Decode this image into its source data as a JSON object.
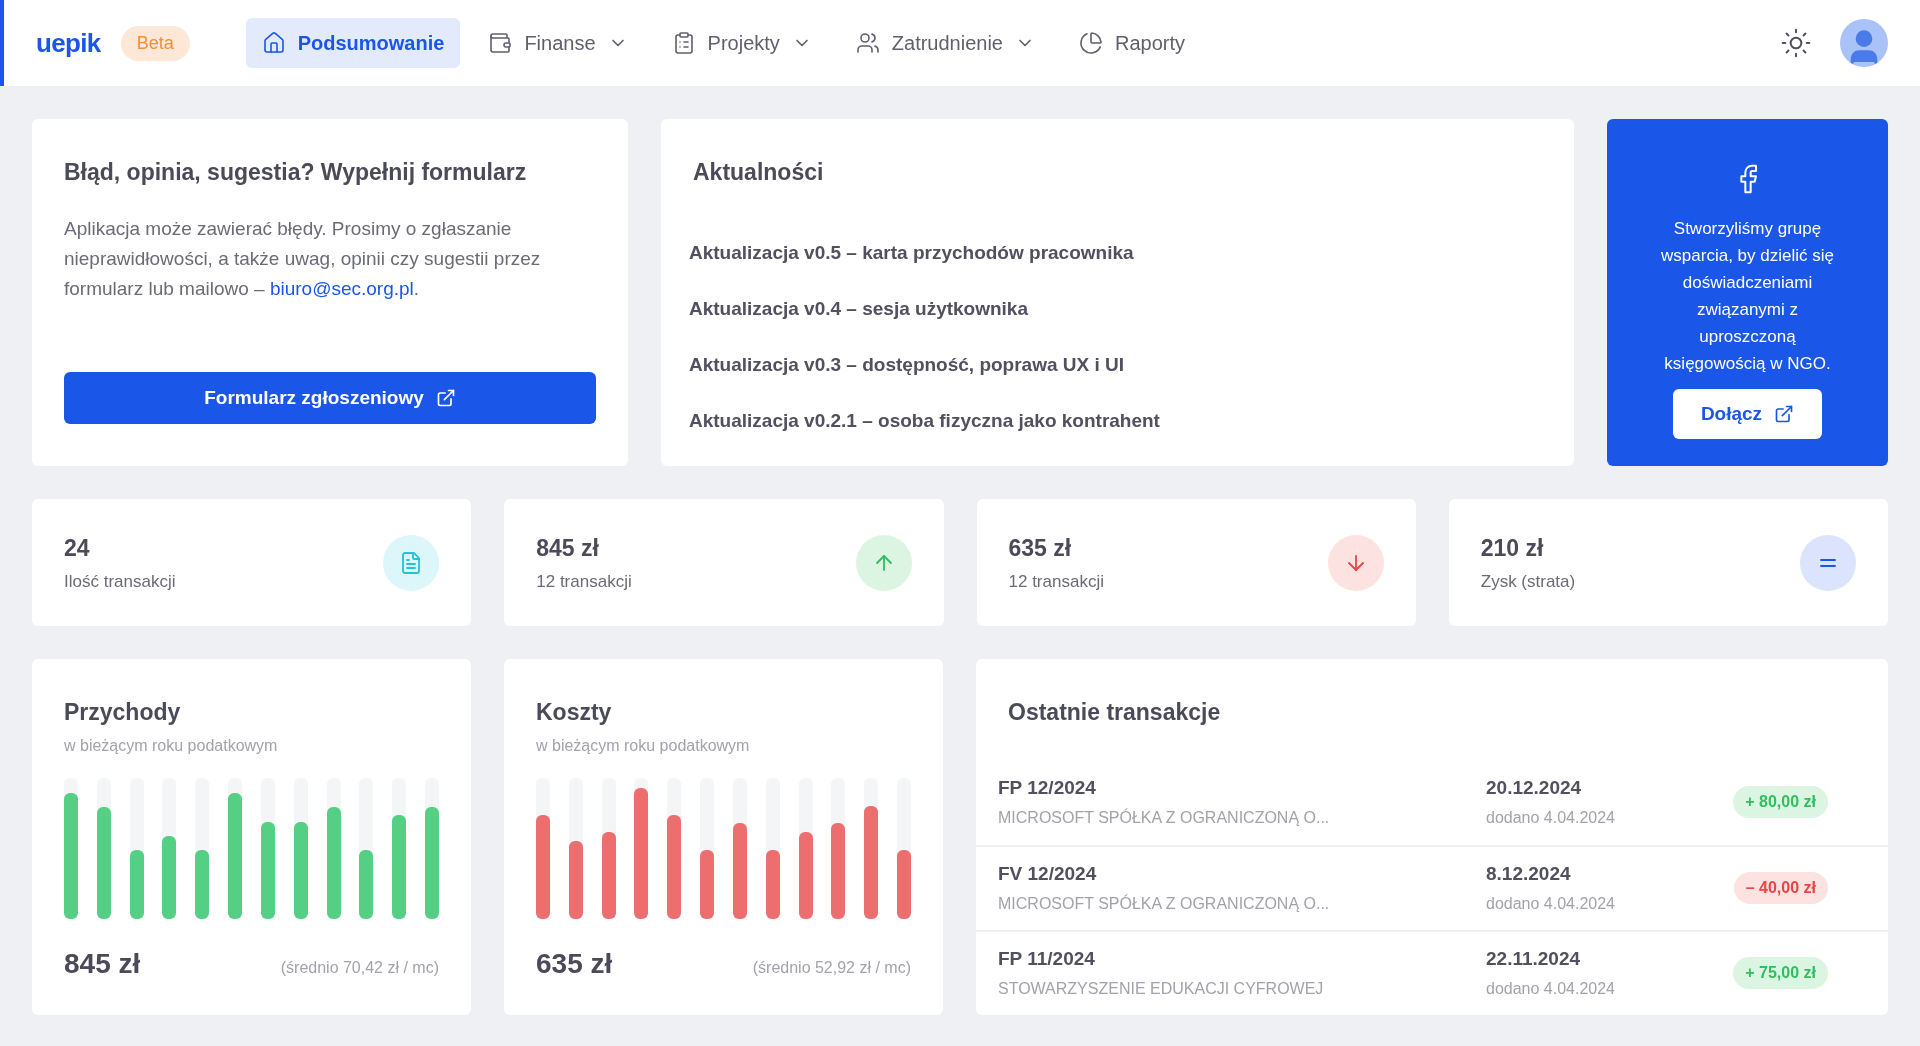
{
  "nav": {
    "logo": "uepik",
    "badge": "Beta",
    "items": [
      {
        "label": "Podsumowanie",
        "selected": true,
        "dropdown": false
      },
      {
        "label": "Finanse",
        "selected": false,
        "dropdown": true
      },
      {
        "label": "Projekty",
        "selected": false,
        "dropdown": true
      },
      {
        "label": "Zatrudnienie",
        "selected": false,
        "dropdown": true
      },
      {
        "label": "Raporty",
        "selected": false,
        "dropdown": false
      }
    ]
  },
  "feedback": {
    "title": "Błąd, opinia, sugestia? Wypełnij formularz",
    "text": "Aplikacja może zawierać błędy. Prosimy o zgłaszanie nieprawidłowości, a także uwag, opinii czy sugestii przez formularz lub mailowo – ",
    "email": "biuro@sec.org.pl",
    "after": ".",
    "button": "Formularz zgłoszeniowy"
  },
  "news": {
    "title": "Aktualności",
    "items": [
      "Aktualizacja v0.5 – karta przychodów pracownika",
      "Aktualizacja v0.4 – sesja użytkownika",
      "Aktualizacja v0.3 – dostępność, poprawa UX i UI",
      "Aktualizacja v0.2.1 – osoba fizyczna jako kontrahent"
    ]
  },
  "group": {
    "text": "Stworzyliśmy grupę wsparcia, by dzielić się doświadczeniami związanymi z uproszczoną księgowością w NGO.",
    "button": "Dołącz"
  },
  "stats": [
    {
      "value": "24",
      "label": "Ilość transakcji",
      "kind": "document"
    },
    {
      "value": "845 zł",
      "label": "12 transakcji",
      "kind": "up"
    },
    {
      "value": "635 zł",
      "label": "12 transakcji",
      "kind": "down"
    },
    {
      "value": "210 zł",
      "label": "Zysk (strata)",
      "kind": "equal"
    }
  ],
  "charts": [
    {
      "title": "Przychody",
      "subtitle": "w bieżącym roku podatkowym",
      "total": "845 zł",
      "average": "(średnio 70,42 zł / mc)",
      "kind": "income"
    },
    {
      "title": "Koszty",
      "subtitle": "w bieżącym roku podatkowym",
      "total": "635 zł",
      "average": "(średnio 52,92 zł / mc)",
      "kind": "costs"
    }
  ],
  "transactions": {
    "title": "Ostatnie transakcje",
    "rows": [
      {
        "number": "FP 12/2024",
        "party": "MICROSOFT SPÓŁKA Z OGRANICZONĄ O...",
        "date": "20.12.2024",
        "added": "dodano 4.04.2024",
        "amount": "+ 80,00 zł",
        "kind": "positive"
      },
      {
        "number": "FV 12/2024",
        "party": "MICROSOFT SPÓŁKA Z OGRANICZONĄ O...",
        "date": "8.12.2024",
        "added": "dodano 4.04.2024",
        "amount": "– 40,00 zł",
        "kind": "negative"
      },
      {
        "number": "FP 11/2024",
        "party": "STOWARZYSZENIE EDUKACJI CYFROWEJ",
        "date": "22.11.2024",
        "added": "dodano 4.04.2024",
        "amount": "+ 75,00 zł",
        "kind": "positive"
      }
    ]
  }
}
